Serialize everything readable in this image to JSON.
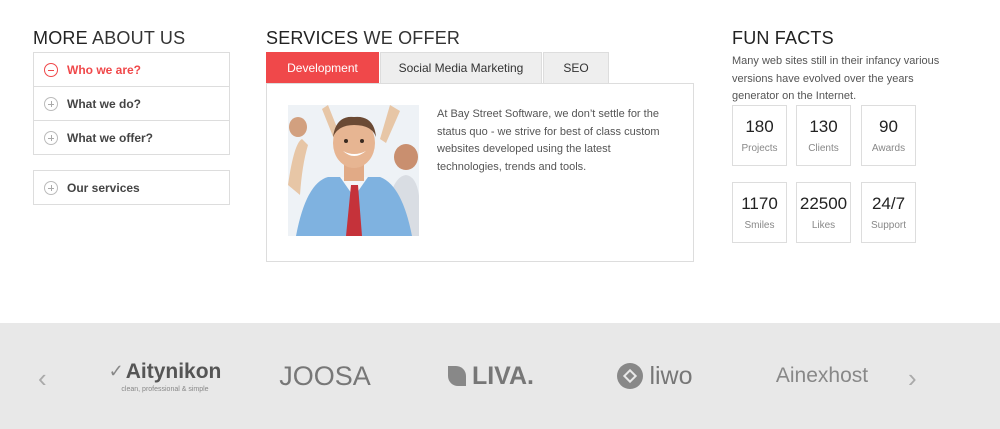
{
  "about": {
    "title_strong": "MORE",
    "title_rest": " ABOUT US",
    "items": [
      {
        "label": "Who we are?",
        "active": true
      },
      {
        "label": "What we do?",
        "active": false
      },
      {
        "label": "What we offer?",
        "active": false
      },
      {
        "label": "Our services",
        "active": false
      }
    ]
  },
  "services": {
    "title_strong": "SERVICES",
    "title_rest": " WE OFFER",
    "tabs": [
      "Development",
      "Social Media Marketing",
      "SEO"
    ],
    "active_tab": "Development",
    "content_text": "At Bay Street Software, we don’t settle for the status quo - we strive for best of class custom websites developed using the latest technologies, trends and tools."
  },
  "facts": {
    "title": "FUN FACTS",
    "description": "Many web sites still in their infancy various versions have evolved over the years generator on the Internet.",
    "items": [
      {
        "value": "180",
        "label": "Projects"
      },
      {
        "value": "130",
        "label": "Clients"
      },
      {
        "value": "90",
        "label": "Awards"
      },
      {
        "value": "1170",
        "label": "Smiles"
      },
      {
        "value": "22500",
        "label": "Likes"
      },
      {
        "value": "24/7",
        "label": "Support"
      }
    ]
  },
  "logos": {
    "prev_arrow": "‹",
    "next_arrow": "›",
    "aitynikon_name": "Aitynikon",
    "aitynikon_tag": "clean, professional & simple",
    "joosa": "JOOSA",
    "liva": "LIVA.",
    "liwo": "liwo",
    "ainexhost": "Ainexhost"
  },
  "colors": {
    "accent": "#f0484a",
    "strip_bg": "#e8e8e8"
  }
}
